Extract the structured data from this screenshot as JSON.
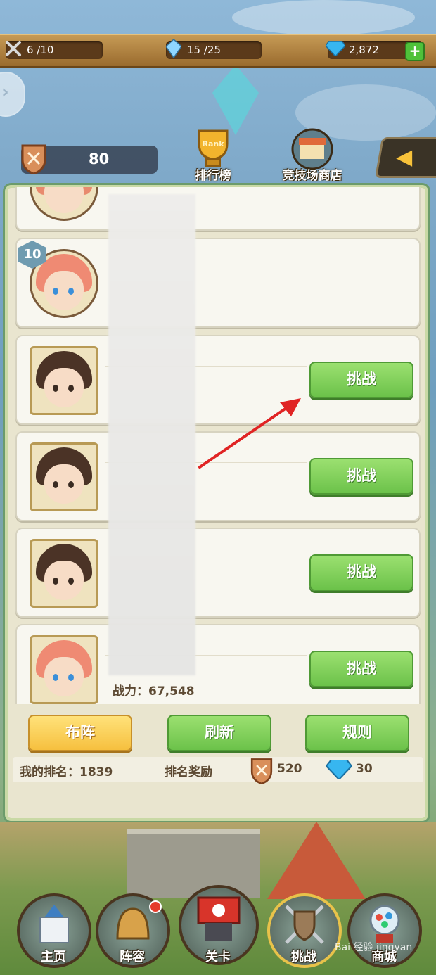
{
  "topbar": {
    "stamina": "6 /10",
    "crystal": "15 /25",
    "diamond": "2,872"
  },
  "score": "80",
  "top_icons": {
    "rank_label": "排行榜",
    "shop_label": "竞技场商店",
    "trophy_text": "Rank"
  },
  "opponents": [
    {
      "challenge_label": ""
    },
    {
      "level": "10",
      "challenge_label": ""
    },
    {
      "challenge_label": "挑战"
    },
    {
      "challenge_label": "挑战"
    },
    {
      "challenge_label": "挑战"
    },
    {
      "challenge_label": "挑战"
    }
  ],
  "power_text": "战力：67,548",
  "actions": {
    "formation": "布阵",
    "refresh": "刷新",
    "rules": "规则"
  },
  "info": {
    "my_rank": "我的排名：1839",
    "reward_label": "排名奖励",
    "reward_medals": "520",
    "reward_diamonds": "30"
  },
  "nav": {
    "home": "主页",
    "team": "阵容",
    "stage": "关卡",
    "challenge": "挑战",
    "shop": "商城"
  },
  "watermark": "Bai 经验 jingyan"
}
